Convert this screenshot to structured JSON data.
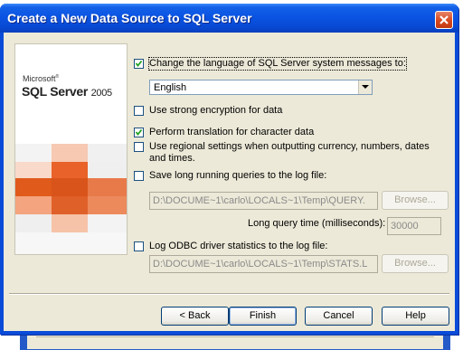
{
  "window": {
    "title": "Create a New Data Source to SQL Server"
  },
  "brand": {
    "company": "Microsoft",
    "product": "SQL Server",
    "version": "2005"
  },
  "options": {
    "change_language": {
      "label": "Change the language of SQL Server system messages to:",
      "checked": true
    },
    "language": {
      "value": "English"
    },
    "strong_encryption": {
      "label": "Use strong encryption for data",
      "checked": false
    },
    "translation": {
      "label": "Perform translation for character data",
      "checked": true
    },
    "regional": {
      "label": "Use regional settings when outputting currency, numbers, dates and times.",
      "checked": false
    },
    "long_queries": {
      "label": "Save long running queries to the log file:",
      "checked": false
    },
    "query_log_path": {
      "value": "D:\\DOCUME~1\\carlo\\LOCALS~1\\Temp\\QUERY."
    },
    "long_query_time": {
      "label": "Long query time (milliseconds):",
      "value": "30000"
    },
    "odbc_stats": {
      "label": "Log ODBC driver statistics to the log file:",
      "checked": false
    },
    "stats_log_path": {
      "value": "D:\\DOCUME~1\\carlo\\LOCALS~1\\Temp\\STATS.L"
    }
  },
  "buttons": {
    "browse1": "Browse...",
    "browse2": "Browse...",
    "back": "< Back",
    "finish": "Finish",
    "cancel": "Cancel",
    "help": "Help"
  },
  "colors": {
    "title_bar": "#0a54e3",
    "dialog_face": "#ece9d8",
    "accent_orange": "#e05a1c"
  }
}
